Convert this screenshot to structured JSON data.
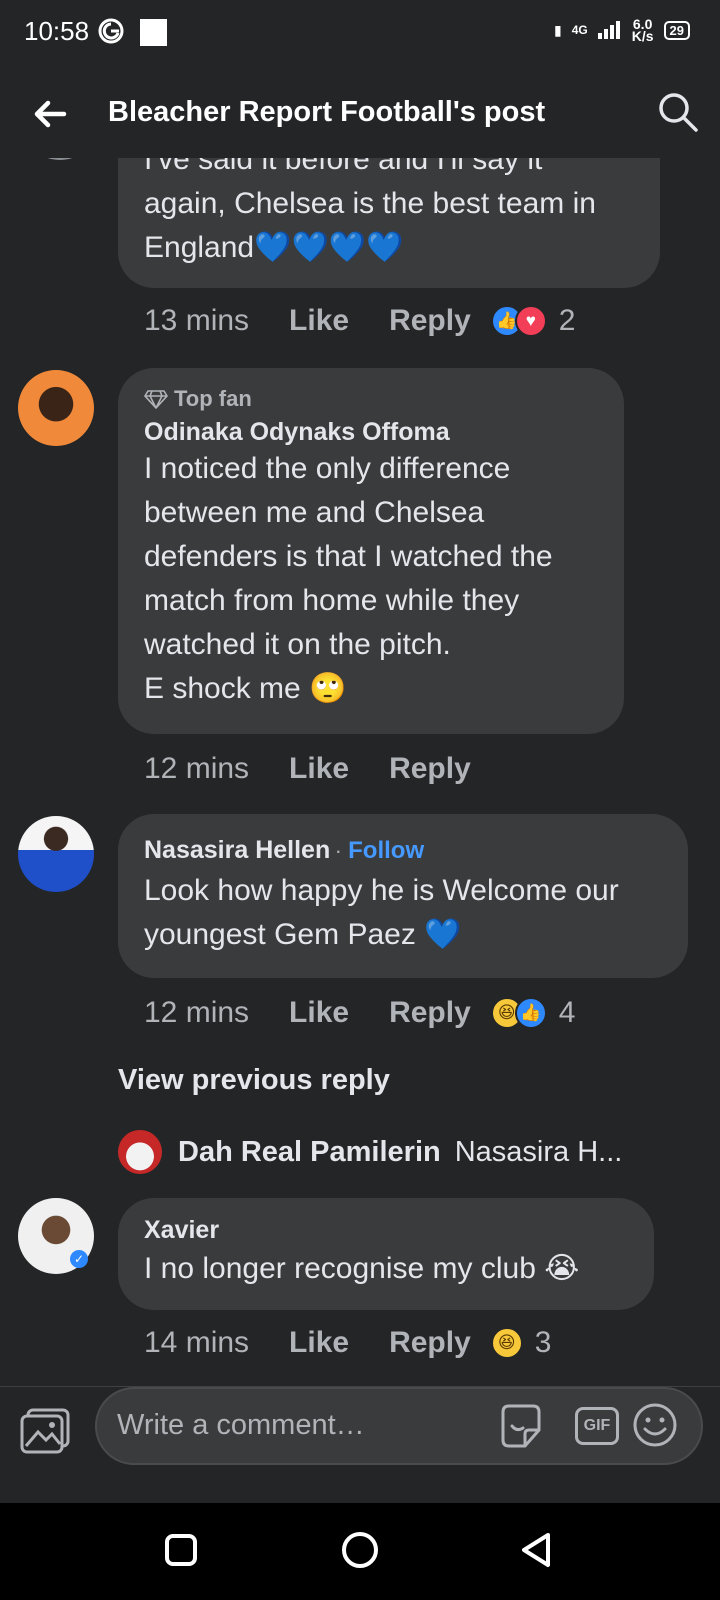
{
  "status_bar": {
    "time": "10:58",
    "net_label": "4G",
    "speed": "6.0",
    "speed_unit": "K/s",
    "battery": "29"
  },
  "header": {
    "title": "Bleacher Report Football's post"
  },
  "comments": [
    {
      "text_lines": [
        "I've said it before and I'll say it",
        "again, Chelsea is the best team in",
        "England💙💙💙💙"
      ],
      "time": "13 mins",
      "like": "Like",
      "reply": "Reply",
      "reaction_count": "2"
    },
    {
      "badge": "Top fan",
      "name": "Odinaka Odynaks Offoma",
      "text_lines": [
        "I noticed the only difference",
        "between me and Chelsea",
        "defenders is that I watched the",
        "match from home while they",
        "watched it on the pitch.",
        "E shock me 🙄"
      ],
      "time": "12 mins",
      "like": "Like",
      "reply": "Reply"
    },
    {
      "name": "Nasasira Hellen",
      "follow": "Follow",
      "text_lines": [
        "Look how happy he is Welcome our",
        "youngest Gem Paez 💙"
      ],
      "time": "12 mins",
      "like": "Like",
      "reply": "Reply",
      "reaction_count": "4"
    },
    {
      "name": "Xavier",
      "text_lines": [
        "I no longer recognise my club 😭"
      ],
      "time": "14 mins",
      "like": "Like",
      "reply": "Reply",
      "reaction_count": "3"
    }
  ],
  "view_previous_reply": "View previous reply",
  "reply_preview": {
    "name": "Dah Real Pamilerin",
    "text": "Nasasira H..."
  },
  "composer": {
    "placeholder": "Write a comment…",
    "gif_label": "GIF"
  },
  "colors": {
    "background": "#242526",
    "bubble": "#3a3b3c",
    "link": "#4599ff",
    "like_blue": "#2e89ff",
    "love_red": "#f33e58"
  }
}
